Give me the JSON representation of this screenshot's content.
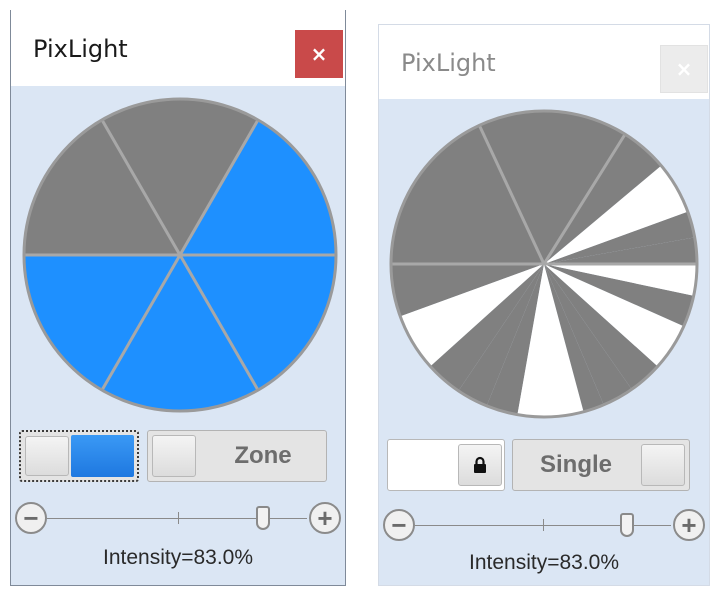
{
  "colors": {
    "zone_selected": "#1e90ff",
    "zone_unselected": "#808080",
    "zone_white": "#ffffff",
    "panel_background": "#dbe6f4",
    "close_button_active": "#c94a4a"
  },
  "icons": {
    "close": "×",
    "lock": "lock-icon",
    "minus": "−",
    "plus": "+"
  },
  "left_window": {
    "title": "PixLight",
    "close_label": "×",
    "mode_label": "Zone",
    "color_swatch": "#1e90ff",
    "zones": [
      "gray",
      "gray",
      "blue",
      "blue",
      "blue",
      "blue",
      "gray"
    ],
    "intensity_percent": 83.0,
    "intensity_text": "Intensity=83.0%"
  },
  "right_window": {
    "title": "PixLight",
    "close_label": "×",
    "mode_label": "Single",
    "color_swatch": "#ffffff",
    "intensity_percent": 83.0,
    "intensity_text": "Intensity=83.0%"
  }
}
